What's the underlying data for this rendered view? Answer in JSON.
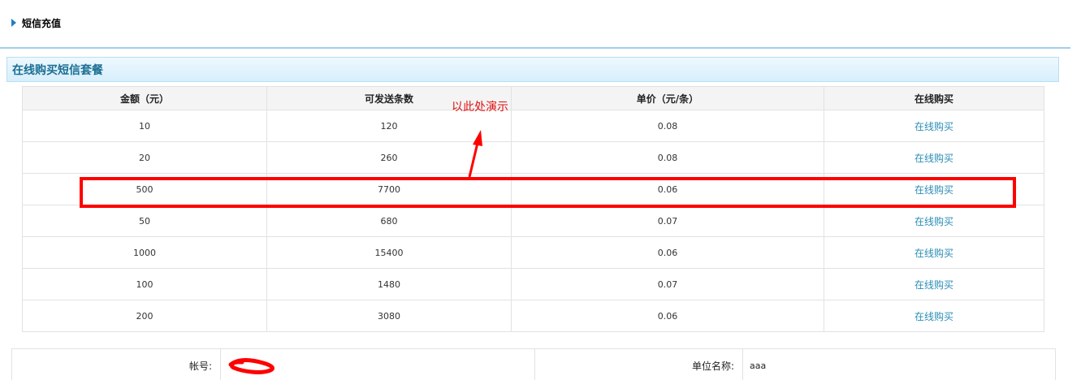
{
  "header": {
    "title": "短信充值"
  },
  "section": {
    "title": "在线购买短信套餐"
  },
  "table": {
    "headers": [
      "金额（元）",
      "可发送条数",
      "单价（元/条）",
      "在线购买"
    ],
    "rows": [
      {
        "amount": "10",
        "count": "120",
        "price": "0.08",
        "buy": "在线购买"
      },
      {
        "amount": "20",
        "count": "260",
        "price": "0.08",
        "buy": "在线购买"
      },
      {
        "amount": "500",
        "count": "7700",
        "price": "0.06",
        "buy": "在线购买"
      },
      {
        "amount": "50",
        "count": "680",
        "price": "0.07",
        "buy": "在线购买"
      },
      {
        "amount": "1000",
        "count": "15400",
        "price": "0.06",
        "buy": "在线购买"
      },
      {
        "amount": "100",
        "count": "1480",
        "price": "0.07",
        "buy": "在线购买"
      },
      {
        "amount": "200",
        "count": "3080",
        "price": "0.06",
        "buy": "在线购买"
      }
    ]
  },
  "annotation": {
    "text": "以此处演示",
    "color": "#ff0000"
  },
  "account": {
    "account_label": "帐号:",
    "account_value": "",
    "org_label": "单位名称:",
    "org_value": "aaa"
  },
  "colors": {
    "accent": "#1a6e93",
    "link": "#2a8db5",
    "annotation": "#ff0000"
  }
}
